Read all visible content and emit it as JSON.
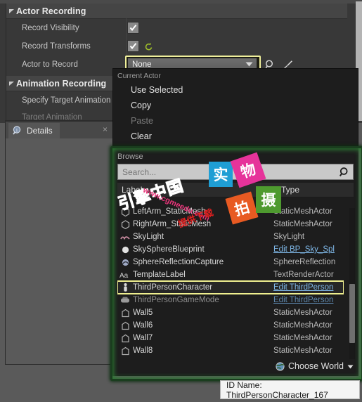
{
  "properties_panel": {
    "sections": [
      {
        "title": "Actor Recording",
        "rows": [
          {
            "label": "Record Visibility",
            "type": "checkbox",
            "checked": true,
            "reset": false
          },
          {
            "label": "Record Transforms",
            "type": "checkbox",
            "checked": true,
            "reset": true
          },
          {
            "label": "Actor to Record",
            "type": "combo",
            "value": "None"
          }
        ]
      },
      {
        "title": "Animation Recording",
        "rows": [
          {
            "label": "Specify Target Animation",
            "type": "text"
          },
          {
            "label": "Target Animation",
            "type": "text",
            "disabled": true
          }
        ]
      }
    ]
  },
  "details_panel": {
    "tab_label": "Details",
    "tab_icon": "info-magnifier-icon",
    "close_label": "×"
  },
  "actor_dropdown": {
    "section_label": "Current Actor",
    "items": [
      {
        "label": "Use Selected",
        "enabled": true
      },
      {
        "label": "Copy",
        "enabled": true
      },
      {
        "label": "Paste",
        "enabled": false
      },
      {
        "label": "Clear",
        "enabled": true
      }
    ]
  },
  "browse_panel": {
    "title": "Browse",
    "search": {
      "placeholder": "Search...",
      "value": ""
    },
    "columns": {
      "label": "Label",
      "type": "Type"
    },
    "rows": [
      {
        "name": "LeftArm_StaticMesh",
        "type": "StaticMeshActor",
        "icon": "staticmesh-icon",
        "link": false,
        "selected": false,
        "dim": false
      },
      {
        "name": "RightArm_StaticMesh",
        "type": "StaticMeshActor",
        "icon": "staticmesh-icon",
        "link": false,
        "selected": false,
        "dim": false
      },
      {
        "name": "SkyLight",
        "type": "SkyLight",
        "icon": "skylight-icon",
        "link": false,
        "selected": false,
        "dim": false
      },
      {
        "name": "SkySphereBlueprint",
        "type": "Edit BP_Sky_Spl",
        "icon": "sphere-icon",
        "link": true,
        "selected": false,
        "dim": false
      },
      {
        "name": "SphereReflectionCapture",
        "type": "SphereReflection",
        "icon": "reflection-icon",
        "link": false,
        "selected": false,
        "dim": false
      },
      {
        "name": "TemplateLabel",
        "type": "TextRenderActor",
        "icon": "text-aa-icon",
        "link": false,
        "selected": false,
        "dim": false
      },
      {
        "name": "ThirdPersonCharacter",
        "type": "Edit ThirdPerson",
        "icon": "character-icon",
        "link": true,
        "selected": true,
        "dim": false
      },
      {
        "name": "ThirdPersonGameMode",
        "type": "Edit ThirdPerson",
        "icon": "gamemode-icon",
        "link": true,
        "selected": false,
        "dim": true
      },
      {
        "name": "Wall5",
        "type": "StaticMeshActor",
        "icon": "wall-icon",
        "link": false,
        "selected": false,
        "dim": false
      },
      {
        "name": "Wall6",
        "type": "StaticMeshActor",
        "icon": "wall-icon",
        "link": false,
        "selected": false,
        "dim": false
      },
      {
        "name": "Wall7",
        "type": "StaticMeshActor",
        "icon": "wall-icon",
        "link": false,
        "selected": false,
        "dim": false
      },
      {
        "name": "Wall8",
        "type": "StaticMeshActor",
        "icon": "wall-icon",
        "link": false,
        "selected": false,
        "dim": false
      }
    ],
    "footer": {
      "world_label": "Choose World",
      "world_icon": "globe-icon"
    }
  },
  "tooltip": {
    "text": "ID Name: ThirdPersonCharacter_167"
  },
  "watermarks": {
    "brand": "引擎中国",
    "url": "www.cgmeedu.com",
    "red_text": "提供下载",
    "blue_box": "实",
    "pink_box": "物",
    "orange_box": "拍",
    "green_box": "摄"
  },
  "colors": {
    "accent_selection": "#efef8f",
    "panel_bg": "#383838",
    "popup_bg": "#1d1d1d",
    "link": "#7fb8e8",
    "glow": "#2d7a33"
  }
}
